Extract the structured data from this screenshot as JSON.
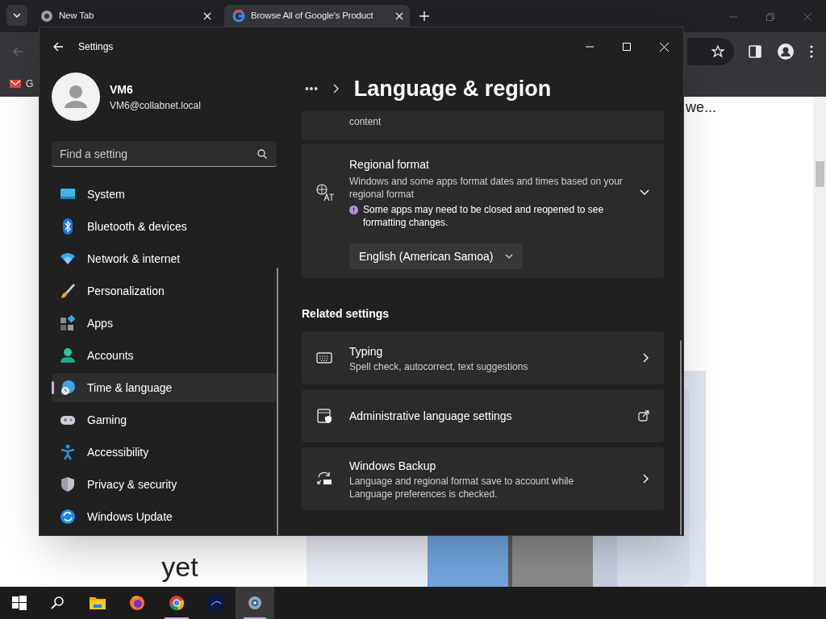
{
  "browser": {
    "tabs": [
      {
        "title": "New Tab",
        "selected": false,
        "kind": "chrome"
      },
      {
        "title": "Browse All of Google's Product",
        "selected": true,
        "kind": "google"
      }
    ],
    "bookmarks": [
      {
        "label": "G"
      }
    ],
    "page": {
      "snippet": "we...",
      "heading_lines": [
        "yet"
      ]
    }
  },
  "settings": {
    "title": "Settings",
    "user": {
      "name": "VM6",
      "email": "VM6@collabnet.local"
    },
    "search": {
      "placeholder": "Find a setting"
    },
    "nav": [
      {
        "label": "System",
        "kind": "system",
        "selected": false
      },
      {
        "label": "Bluetooth & devices",
        "kind": "bluetooth",
        "selected": false
      },
      {
        "label": "Network & internet",
        "kind": "network",
        "selected": false
      },
      {
        "label": "Personalization",
        "kind": "brush",
        "selected": false
      },
      {
        "label": "Apps",
        "kind": "apps",
        "selected": false
      },
      {
        "label": "Accounts",
        "kind": "accounts",
        "selected": false
      },
      {
        "label": "Time & language",
        "kind": "time",
        "selected": true
      },
      {
        "label": "Gaming",
        "kind": "gaming",
        "selected": false
      },
      {
        "label": "Accessibility",
        "kind": "accessibility",
        "selected": false
      },
      {
        "label": "Privacy & security",
        "kind": "shield",
        "selected": false
      },
      {
        "label": "Windows Update",
        "kind": "update",
        "selected": false
      }
    ],
    "breadcrumb": {
      "more": "•••",
      "title": "Language & region"
    },
    "partial_card": {
      "description": "content"
    },
    "regional_format": {
      "title": "Regional format",
      "description": "Windows and some apps format dates and times based on your regional format",
      "notice": "Some apps may need to be closed and reopened to see formatting changes.",
      "value": "English (American Samoa)",
      "expanded": true
    },
    "related": {
      "heading": "Related settings",
      "items": [
        {
          "kind": "typing",
          "title": "Typing",
          "description": "Spell check, autocorrect, text suggestions"
        },
        {
          "kind": "admin",
          "title": "Administrative language settings"
        },
        {
          "kind": "backup",
          "title": "Windows Backup",
          "description": "Language and regional format save to account while Language preferences is checked."
        }
      ]
    }
  },
  "taskbar": {
    "apps": [
      {
        "kind": "start",
        "selected": false
      },
      {
        "kind": "search",
        "selected": false
      },
      {
        "kind": "files",
        "selected": false
      },
      {
        "kind": "firefox",
        "selected": false
      },
      {
        "kind": "chrome",
        "selected": false,
        "open": true
      },
      {
        "kind": "disney",
        "selected": false
      },
      {
        "kind": "settings",
        "selected": true,
        "open": true
      }
    ]
  }
}
